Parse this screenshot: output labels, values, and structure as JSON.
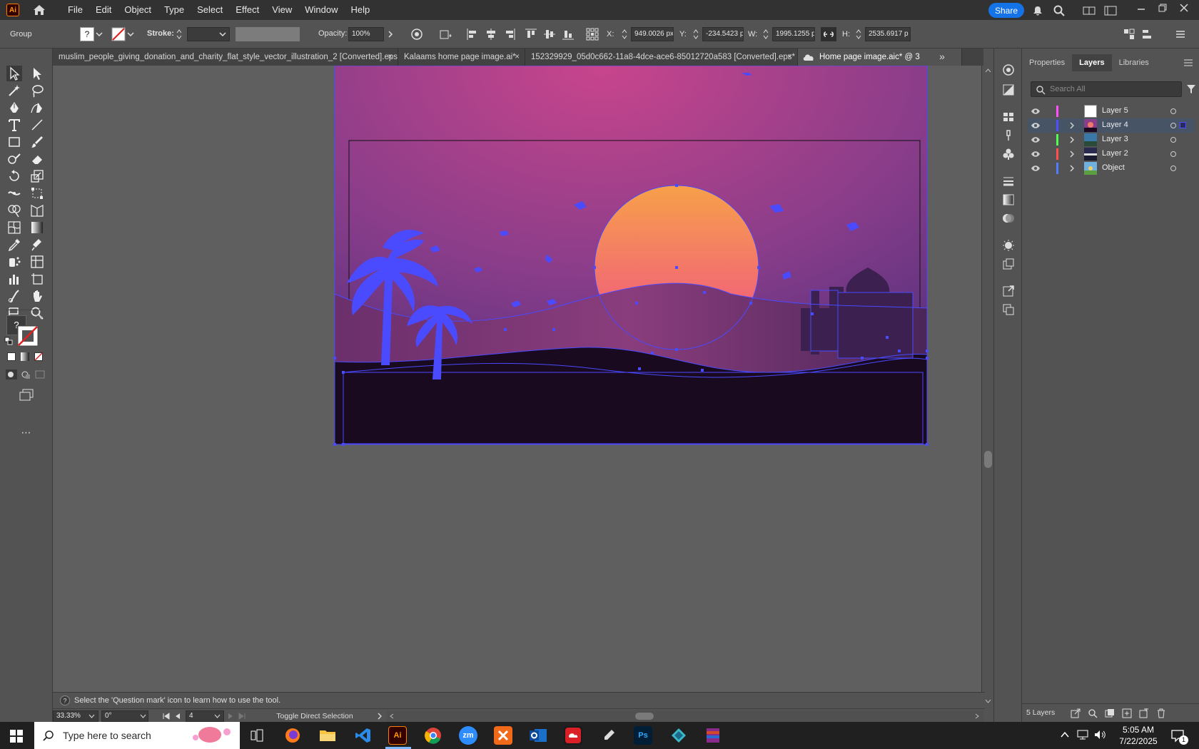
{
  "menubar": {
    "items": [
      "File",
      "Edit",
      "Object",
      "Type",
      "Select",
      "Effect",
      "View",
      "Window",
      "Help"
    ],
    "share_label": "Share"
  },
  "controlbar": {
    "selection_type": "Group",
    "stroke_label": "Stroke:",
    "opacity_label": "Opacity:",
    "opacity_value": "100%",
    "x_label": "X:",
    "x_value": "949.0026 px",
    "y_label": "Y:",
    "y_value": "-234.5423 px",
    "w_label": "W:",
    "w_value": "1995.1255 p",
    "h_label": "H:",
    "h_value": "2535.6917 p",
    "fill_value": "?"
  },
  "tabs": [
    {
      "label": "muslim_people_giving_donation_and_charity_flat_style_vector_illustration_2 [Converted].eps",
      "close": "×"
    },
    {
      "label": "Kalaams home page image.ai*",
      "close": "×"
    },
    {
      "label": "152329929_05d0c662-11a8-4dce-ace6-85012720a583 [Converted].eps*",
      "close": "×"
    },
    {
      "label": "Home page image.aic* @ 3",
      "close": ""
    }
  ],
  "tab_overflow": "»",
  "panel": {
    "tabs": [
      "Properties",
      "Layers",
      "Libraries"
    ],
    "active_tab": "Layers",
    "search_placeholder": "Search All",
    "layers": [
      {
        "name": "Layer 5",
        "color": "#ff4fff",
        "expanded": false,
        "selected": false
      },
      {
        "name": "Layer 4",
        "color": "#4f4fff",
        "expanded": true,
        "selected": true
      },
      {
        "name": "Layer 3",
        "color": "#4fff4f",
        "expanded": true,
        "selected": false
      },
      {
        "name": "Layer 2",
        "color": "#ff4f4f",
        "expanded": true,
        "selected": false
      },
      {
        "name": "Object",
        "color": "#4f7fff",
        "expanded": true,
        "selected": false
      }
    ],
    "layer_count": "5 Layers"
  },
  "status": {
    "zoom": "33.33%",
    "rotation": "0°",
    "artboard": "4",
    "tool_status": "Toggle Direct Selection",
    "hint": "Select the 'Question mark' icon to learn how to use the tool."
  },
  "taskbar": {
    "search_placeholder": "Type here to search",
    "time": "5:05 AM",
    "date": "7/22/2025",
    "notification_count": "1",
    "apps": [
      "Ai",
      "zm",
      "Ps"
    ]
  },
  "colors": {
    "selection": "#4a4aff",
    "accent": "#1473e6",
    "sky_top": "#c8458c",
    "sun_top": "#f7a04a",
    "sun_bottom": "#ef4f86",
    "ground": "#1a0a20"
  }
}
